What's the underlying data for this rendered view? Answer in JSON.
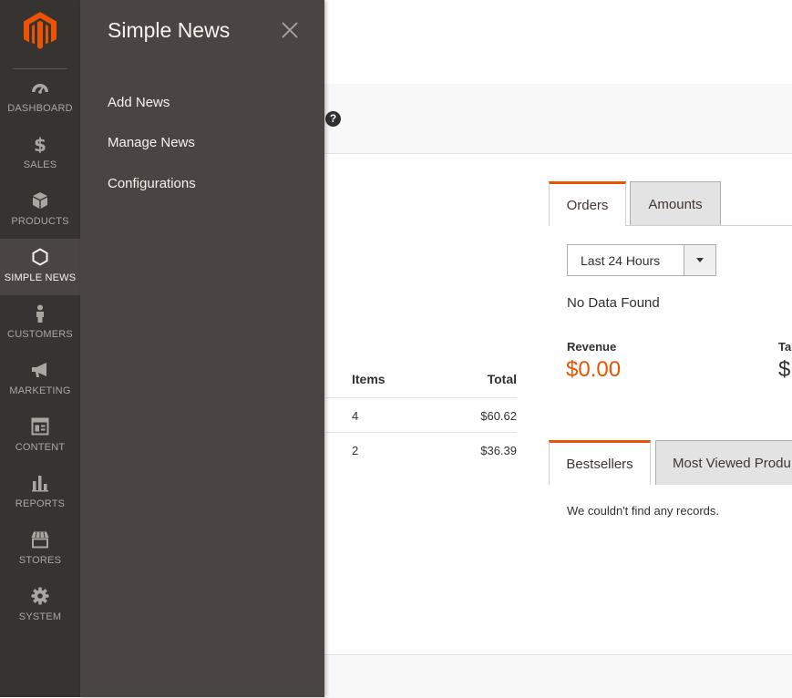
{
  "nav": {
    "items": [
      {
        "label": "DASHBOARD",
        "icon": "dashboard-icon"
      },
      {
        "label": "SALES",
        "icon": "dollar-icon"
      },
      {
        "label": "PRODUCTS",
        "icon": "box-icon"
      },
      {
        "label": "SIMPLE NEWS",
        "icon": "hexagon-icon"
      },
      {
        "label": "CUSTOMERS",
        "icon": "person-icon"
      },
      {
        "label": "MARKETING",
        "icon": "megaphone-icon"
      },
      {
        "label": "CONTENT",
        "icon": "layout-icon"
      },
      {
        "label": "REPORTS",
        "icon": "bar-chart-icon"
      },
      {
        "label": "STORES",
        "icon": "store-icon"
      },
      {
        "label": "SYSTEM",
        "icon": "gear-icon"
      }
    ],
    "active": "SIMPLE NEWS"
  },
  "flyout": {
    "title": "Simple News",
    "links": [
      "Add News",
      "Manage News",
      "Configurations"
    ]
  },
  "help_glyph": "?",
  "orders_table": {
    "headers": [
      "Items",
      "Total"
    ],
    "rows": [
      {
        "items": "4",
        "total": "$60.62"
      },
      {
        "items": "2",
        "total": "$36.39"
      }
    ]
  },
  "chart_tabs": [
    "Orders",
    "Amounts"
  ],
  "period_select": {
    "value": "Last 24 Hours"
  },
  "no_data": "No Data Found",
  "totals": [
    {
      "label": "Revenue",
      "value": "$0.00"
    },
    {
      "label": "Ta",
      "value": "$"
    }
  ],
  "grid_tabs": [
    "Bestsellers",
    "Most Viewed Produ"
  ],
  "empty_message": "We couldn't find any records.",
  "colors": {
    "accent": "#eb5202",
    "nav_bg": "#373330",
    "flyout_bg": "#4a4542"
  }
}
